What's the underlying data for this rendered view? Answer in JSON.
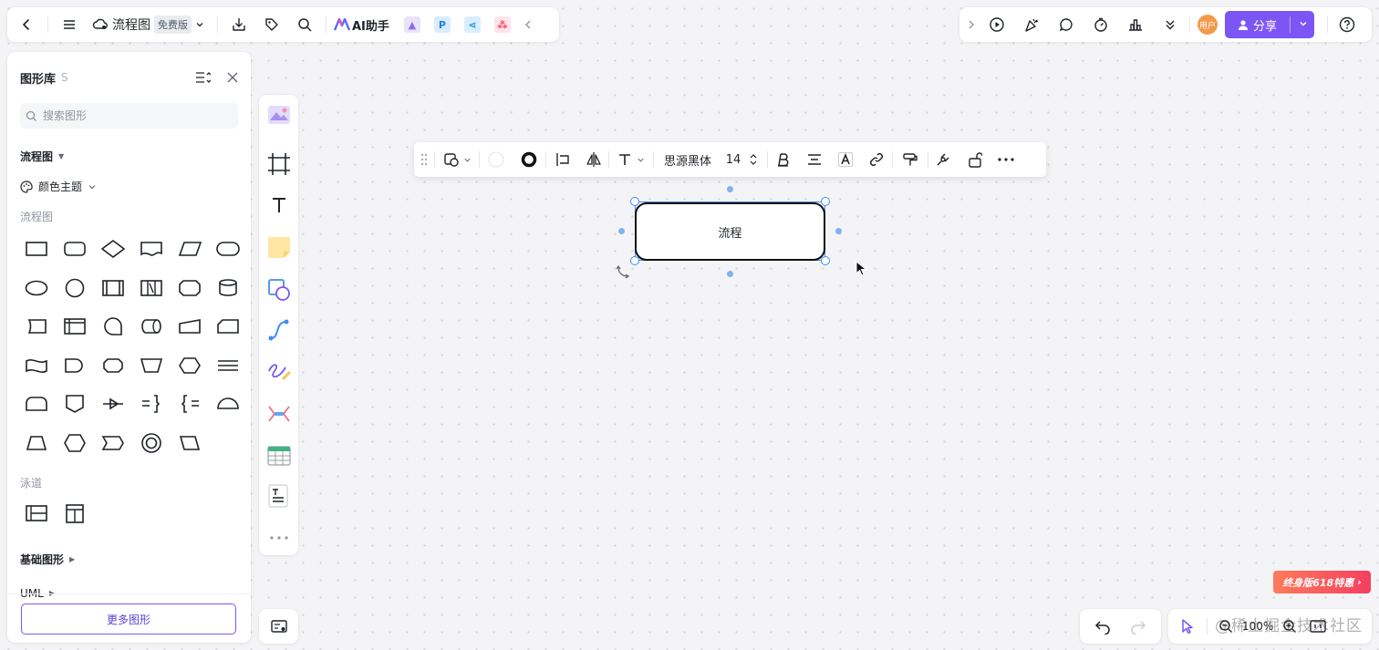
{
  "app": {
    "doc_title": "流程图",
    "plan_badge": "免费版",
    "ai_label": "AI助手"
  },
  "share": {
    "label": "分享"
  },
  "user": {
    "avatar_text": "用户"
  },
  "library": {
    "title": "图形库",
    "shortcut": "S",
    "search_placeholder": "搜索图形",
    "section_flowchart": "流程图",
    "color_theme": "颜色主题",
    "sub_flowchart": "流程图",
    "sub_swimlane": "泳道",
    "section_basic": "基础图形",
    "section_uml": "UML",
    "more_button": "更多图形"
  },
  "format_toolbar": {
    "font_name": "思源黑体",
    "font_size": "14"
  },
  "canvas": {
    "node_label": "流程"
  },
  "zoom": {
    "level": "100%"
  },
  "promo": {
    "label": "终身版618特惠"
  },
  "watermark": "@稀土掘金技术社区",
  "colors": {
    "accent": "#7c56f5",
    "selection": "#3e8df4"
  }
}
